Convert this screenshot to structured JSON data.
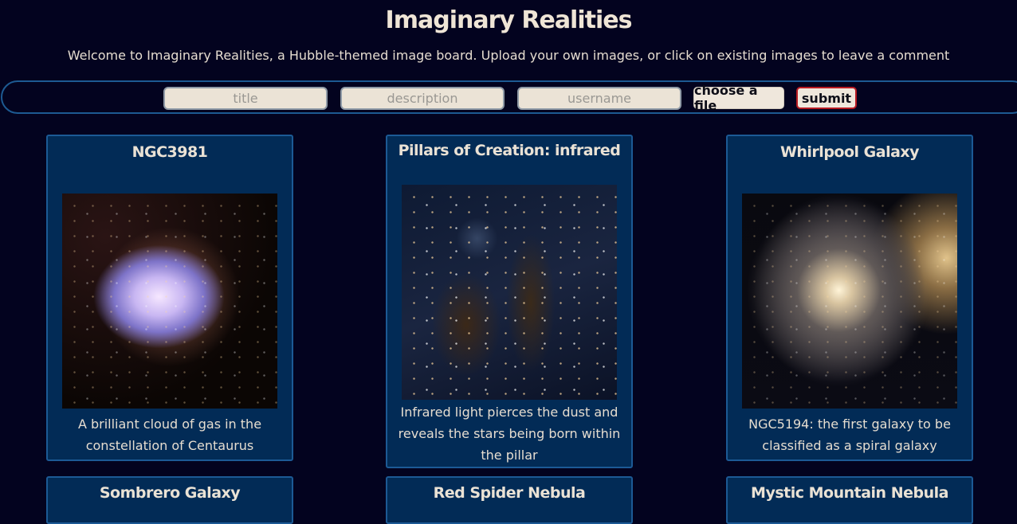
{
  "header": {
    "title": "Imaginary Realities",
    "subtitle": "Welcome to Imaginary Realities, a Hubble-themed image board. Upload your own images, or click on existing images to leave a comment"
  },
  "upload_form": {
    "title_placeholder": "title",
    "description_placeholder": "description",
    "username_placeholder": "username",
    "file_button": "choose a file",
    "submit_button": "submit"
  },
  "colors": {
    "background": "#03031f",
    "card_background": "#022b56",
    "card_border": "#1c5a95",
    "submit_border": "#b81a22"
  },
  "cards": [
    {
      "title": "NGC3981",
      "description": "A brilliant cloud of gas in the constellation of Centaurus",
      "image": "nebula-photo"
    },
    {
      "title": "Pillars of Creation: infrared",
      "description": "Infrared light pierces the dust and reveals the stars being born within the pillar",
      "image": "pillars-photo"
    },
    {
      "title": "Whirlpool Galaxy",
      "description": "NGC5194: the first galaxy to be classified as a spiral galaxy",
      "image": "spiral-galaxy-photo"
    },
    {
      "title": "Sombrero Galaxy"
    },
    {
      "title": "Red Spider Nebula"
    },
    {
      "title": "Mystic Mountain Nebula"
    }
  ]
}
